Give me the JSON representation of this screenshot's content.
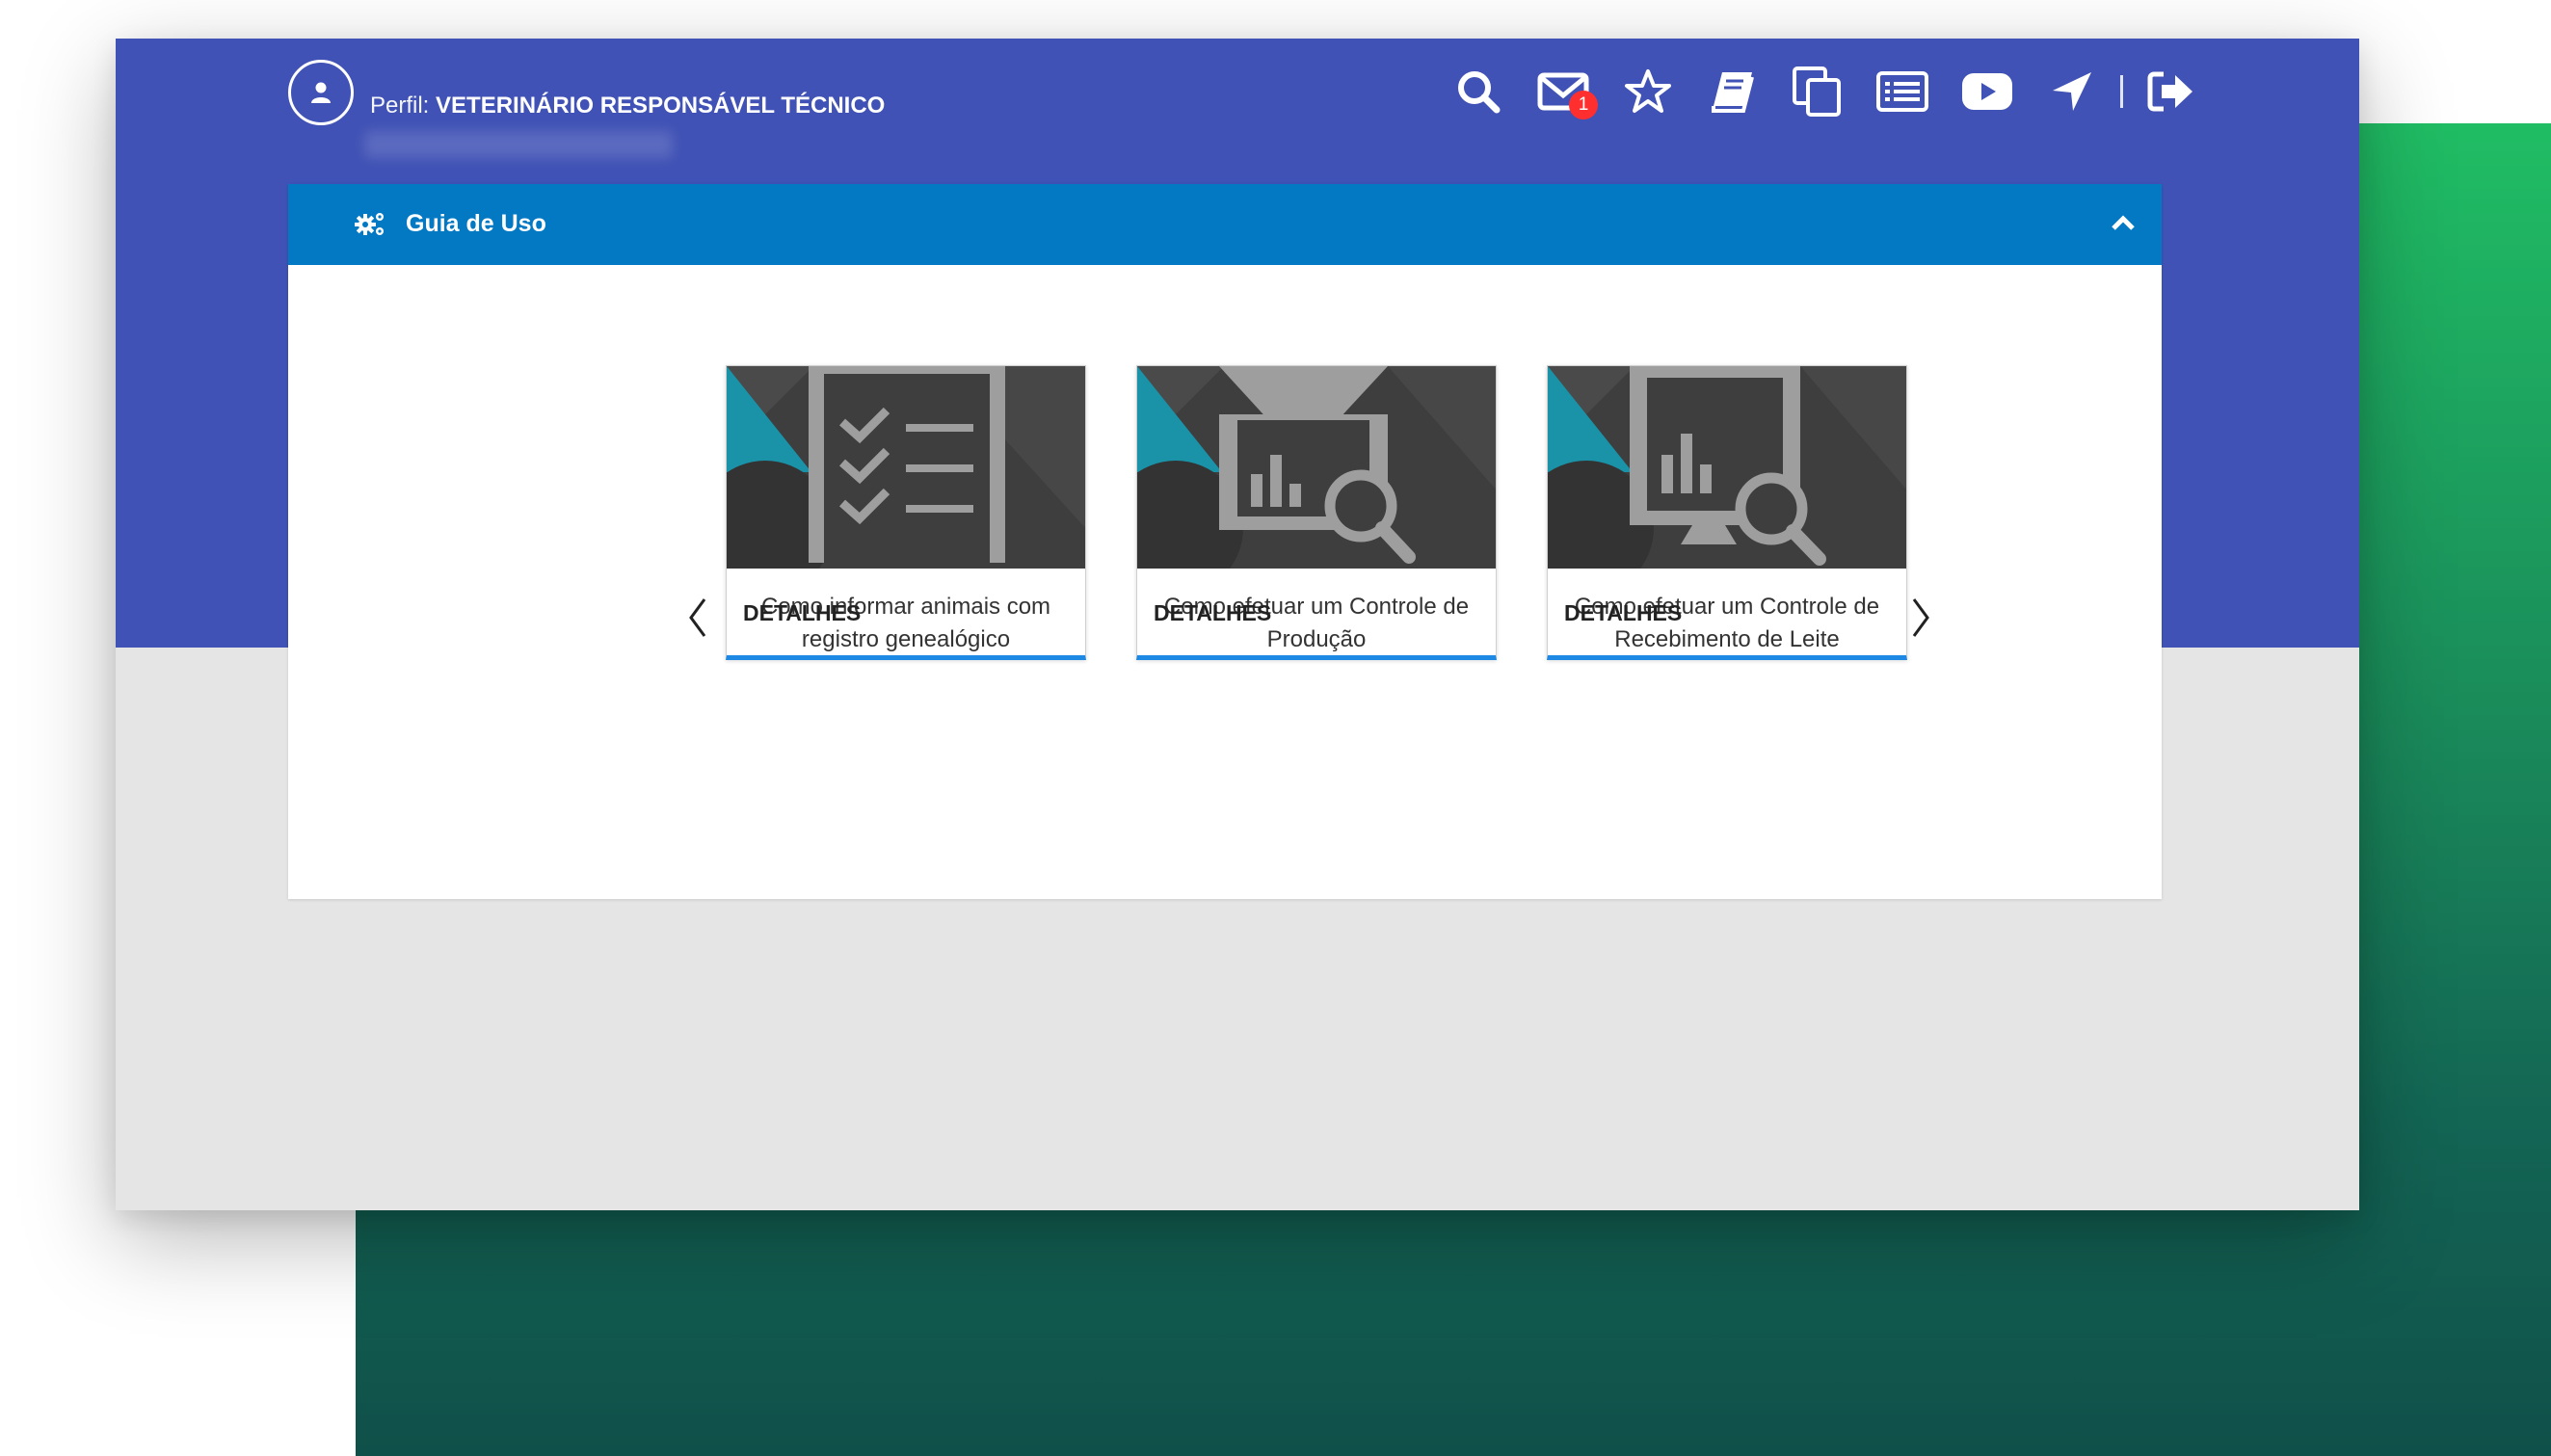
{
  "header": {
    "profile_label": "Perfil:",
    "profile_value": "VETERINÁRIO RESPONSÁVEL TÉCNICO",
    "messages_badge": "1"
  },
  "toolbar_icons": [
    "search-icon",
    "mail-icon",
    "star-icon",
    "book-icon",
    "copy-icon",
    "list-icon",
    "youtube-icon",
    "location-arrow-icon",
    "logout-icon"
  ],
  "panel": {
    "title": "Guia de Uso"
  },
  "cards": [
    {
      "title": "Como informar animais com registro genealógico",
      "link": "DETALHES",
      "icon": "checklist-icon"
    },
    {
      "title": "Como efetuar um Controle de Produção",
      "link": "DETALHES",
      "icon": "report-search-icon"
    },
    {
      "title": "Como efetuar um Controle de Recebimento de Leite",
      "link": "DETALHES",
      "icon": "monitor-search-icon"
    }
  ],
  "colors": {
    "header_bg": "#4052b5",
    "panel_head_bg": "#0378c3",
    "card_accent": "#1e88e5",
    "badge": "#ff2f2f",
    "green_gradient_top": "#20bd64",
    "green_gradient_bottom": "#10504a"
  }
}
